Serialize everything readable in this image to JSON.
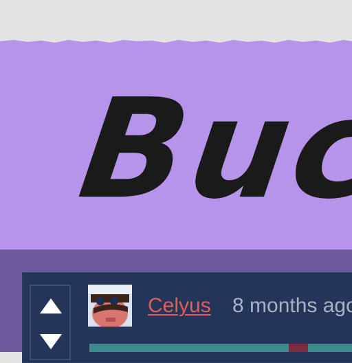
{
  "banner": {
    "title": "Buc"
  },
  "comment": {
    "username": "Celyus",
    "timestamp": "8 months ago",
    "avatar_icon": "avatar-icon"
  },
  "vote": {
    "up_icon": "upvote-arrow-icon",
    "down_icon": "downvote-arrow-icon"
  },
  "colors": {
    "banner_bg": "#b594ea",
    "card_bg": "#243559",
    "username": "#e85a5a",
    "timestamp": "#a9b3c7"
  }
}
